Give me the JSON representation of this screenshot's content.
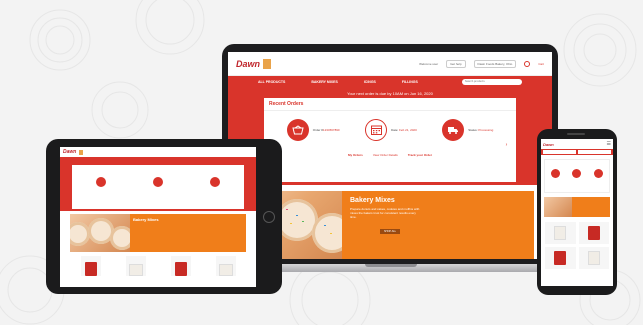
{
  "laptop": {
    "logo": "Dawn",
    "util_links": [
      "Welcome user",
      "Get help",
      "Dawn Foods Bakery, Ohio",
      "Cart"
    ],
    "nav": [
      "ALL PRODUCTS",
      "BAKERY MIXES",
      "ICINGS",
      "FILLINGS"
    ],
    "search_placeholder": "Search products",
    "order_due": "Your next order is due by 10AM on Jun 16, 2020",
    "recent_orders_title": "Recent Orders",
    "orders": [
      {
        "label": "Order #",
        "value": "1234567890",
        "icon": "shopping-basket-icon"
      },
      {
        "label": "Date: ",
        "value": "Feb 21, 2020",
        "icon": "calendar-icon"
      },
      {
        "label": "Status: ",
        "value": "Processing",
        "icon": "delivery-truck-icon"
      }
    ],
    "order_links": [
      "My Orders",
      "View Order Details",
      "Track your Order"
    ],
    "hero": {
      "title": "Bakery Mixes",
      "description": "Prepare donuts and cakes, cookies and muffins with mixes the bakers trust for consistent results every time.",
      "button": "SHOP ALL"
    }
  },
  "tablet": {
    "logo": "Dawn",
    "hero_title": "Bakery Mixes"
  },
  "phone": {
    "logo": "Dawn"
  },
  "colors": {
    "brand_red": "#d9342b",
    "hero_orange": "#f07e1a",
    "device_frame": "#1b1b1c"
  }
}
